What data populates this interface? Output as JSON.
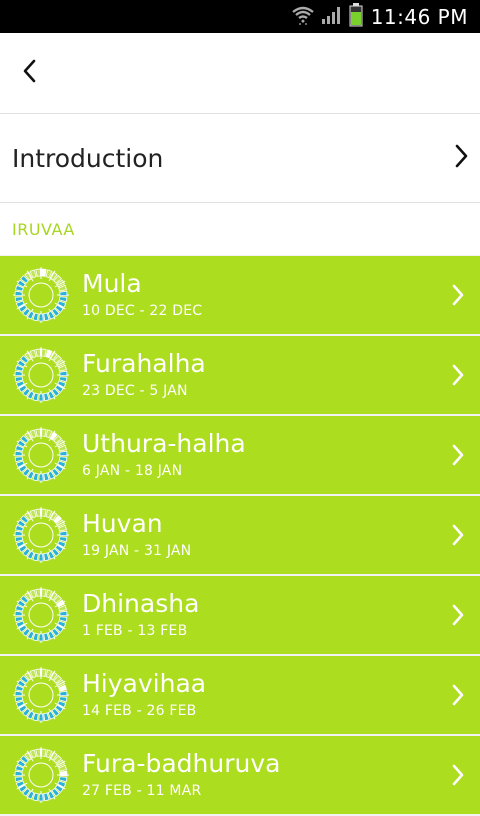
{
  "status_bar": {
    "time": "11:46 PM",
    "icons": [
      "wifi-icon",
      "signal-icon",
      "battery-icon"
    ],
    "battery_color": "#7bd12b"
  },
  "header": {
    "back_icon": "chevron-left-icon"
  },
  "intro": {
    "label": "Introduction",
    "icon": "chevron-right-icon"
  },
  "section": {
    "title": "IRUVAA",
    "accent": "#a8d622"
  },
  "colors": {
    "row_bg": "#acdd1e",
    "ring_blue": "#2bb2d6"
  },
  "items": [
    {
      "title": "Mula",
      "dates": "10 DEC - 22 DEC",
      "marker_index": 0
    },
    {
      "title": "Furahalha",
      "dates": "23 DEC - 5 JAN",
      "marker_index": 1
    },
    {
      "title": "Uthura-halha",
      "dates": "6 JAN - 18 JAN",
      "marker_index": 2
    },
    {
      "title": "Huvan",
      "dates": "19 JAN - 31 JAN",
      "marker_index": 3
    },
    {
      "title": "Dhinasha",
      "dates": "1 FEB - 13 FEB",
      "marker_index": 4
    },
    {
      "title": "Hiyavihaa",
      "dates": "14 FEB - 26 FEB",
      "marker_index": 5
    },
    {
      "title": "Fura-badhuruva",
      "dates": "27 FEB - 11 MAR",
      "marker_index": 6
    }
  ]
}
